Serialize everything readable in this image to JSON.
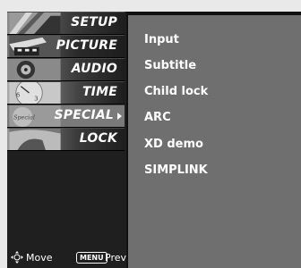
{
  "sidebar": {
    "items": [
      {
        "label": "SETUP",
        "icon": "setup-thumbnail"
      },
      {
        "label": "PICTURE",
        "icon": "picture-thumbnail"
      },
      {
        "label": "AUDIO",
        "icon": "audio-thumbnail"
      },
      {
        "label": "TIME",
        "icon": "time-thumbnail"
      },
      {
        "label": "SPECIAL",
        "icon": "special-thumbnail",
        "active": true
      },
      {
        "label": "LOCK",
        "icon": "lock-thumbnail"
      }
    ]
  },
  "panel": {
    "options": [
      "Input",
      "Subtitle",
      "Child lock",
      "ARC",
      "XD demo",
      "SIMPLINK"
    ]
  },
  "footer": {
    "move": "Move",
    "menu_key": "MENU",
    "prev": "Prev"
  },
  "colors": {
    "sidebar_bg": "#1f1f1f",
    "panel_bg": "#6f6f6f",
    "active_item_bg": "#7a7a7a",
    "text": "#ffffff"
  }
}
